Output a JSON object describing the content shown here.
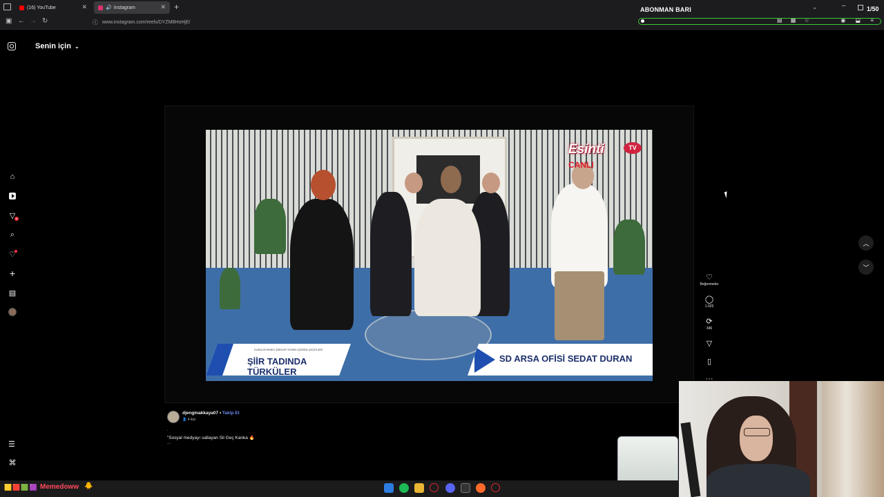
{
  "browser": {
    "tabs": [
      {
        "label": "(16) YouTube",
        "favicon_color": "#ff0000"
      },
      {
        "label": "Instagram",
        "favicon_color": "#e1306c"
      }
    ],
    "url": "www.instagram.com/reels/DYZM8HoHjE/",
    "abonman_label": "ABONMAN BARI",
    "abonman_counter": "1/50",
    "abonman_progress": 0.0,
    "abonman_bar_color": "#39c93a"
  },
  "instagram": {
    "feed_title": "Senin için",
    "rail_icons": [
      {
        "icon": "home-icon",
        "glyph": "⌂"
      },
      {
        "icon": "reels-icon",
        "glyph": "▶"
      },
      {
        "icon": "messages-icon",
        "glyph": "▽",
        "badge": "4"
      },
      {
        "icon": "search-icon",
        "glyph": "⌕"
      },
      {
        "icon": "notifications-icon",
        "glyph": "♡"
      },
      {
        "icon": "create-icon",
        "glyph": "+"
      },
      {
        "icon": "dashboard-icon",
        "glyph": "▤"
      },
      {
        "icon": "profile-avatar-icon",
        "glyph": ""
      }
    ],
    "more_icon": "☰",
    "threads_icon": "@",
    "video": {
      "channel_logo": "Esinti",
      "channel_logo_tv": "TV",
      "live_label": "CANLI",
      "lower_third_left_small": "DURA DİYEMEZ ŞİİRLER TEDEN İÇEREN ÇEŞİTLERİ",
      "lower_third_left": "ŞİİR TADINDA TÜRKÜLER",
      "lower_third_right": "SD ARSA OFİSİ SEDAT DURAN"
    },
    "actions": {
      "like_label": "Beğenmeler",
      "comments_count": "1.025",
      "reposts_count": "346"
    },
    "post": {
      "username": "djenginakkaya07",
      "separator": " • ",
      "follow_label": "Takip Et",
      "audio_label": "4 kişi",
      "caption_prefix": ".",
      "caption": "\"Sosyal medyayı sallayan Sil Geç Kanka 🔥",
      "caption_suffix": "..."
    }
  },
  "taskbar": {
    "streamer_name": "Memedoww",
    "streamer_emoji": "🐥",
    "stream_icons": "🟨🟥🟩🟪"
  },
  "colors": {
    "background": "#000000",
    "follow_link": "#6e8cf6",
    "notification_badge": "#ff3040",
    "streamer_name": "#ff4a5c"
  }
}
